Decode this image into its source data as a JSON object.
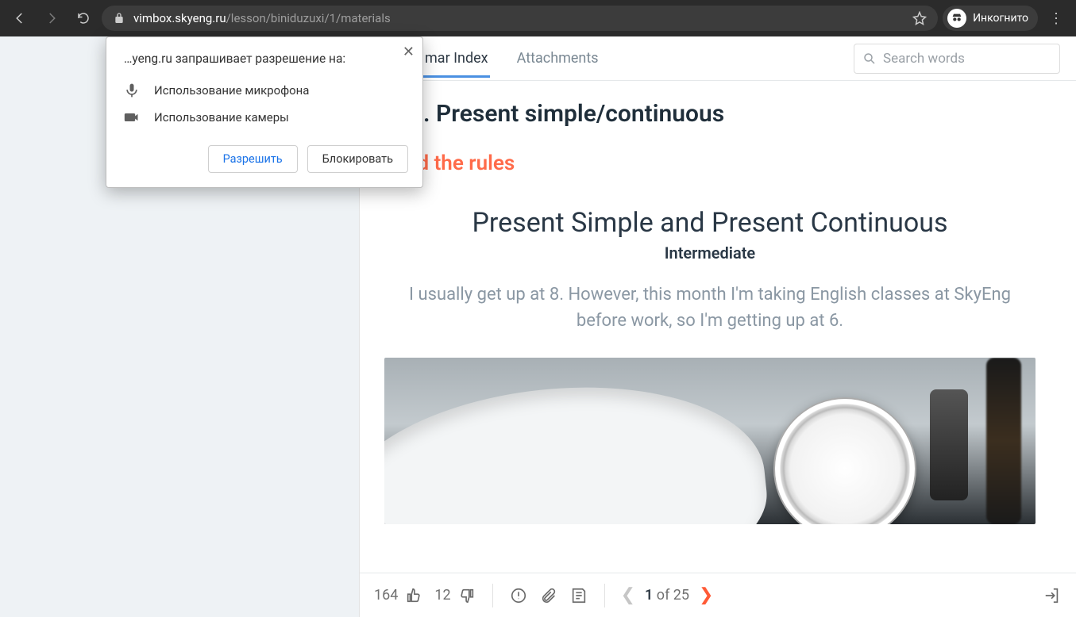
{
  "browser": {
    "url_domain": "vimbox.skyeng.ru",
    "url_path": "/lesson/biniduzuxi/1/materials",
    "incognito_label": "Инкогнито"
  },
  "permission": {
    "title": "…yeng.ru запрашивает разрешение на:",
    "mic": "Использование микрофона",
    "cam": "Использование камеры",
    "allow": "Разрешить",
    "block": "Блокировать"
  },
  "tabs": {
    "grammar": "mar Index",
    "attachments": "Attachments"
  },
  "search": {
    "placeholder": "Search words"
  },
  "lesson": {
    "title": ". Present simple/continuous",
    "section": "Read the rules",
    "rule_title": "Present Simple and Present Continuous",
    "rule_subtitle": "Intermediate",
    "rule_body": "I usually get up at 8. However, this month I'm taking English classes at SkyEng before work, so I'm getting up at 6."
  },
  "bottom": {
    "likes": "164",
    "dislikes": "12",
    "pager_current": "1",
    "pager_of": "of",
    "pager_total": "25"
  }
}
